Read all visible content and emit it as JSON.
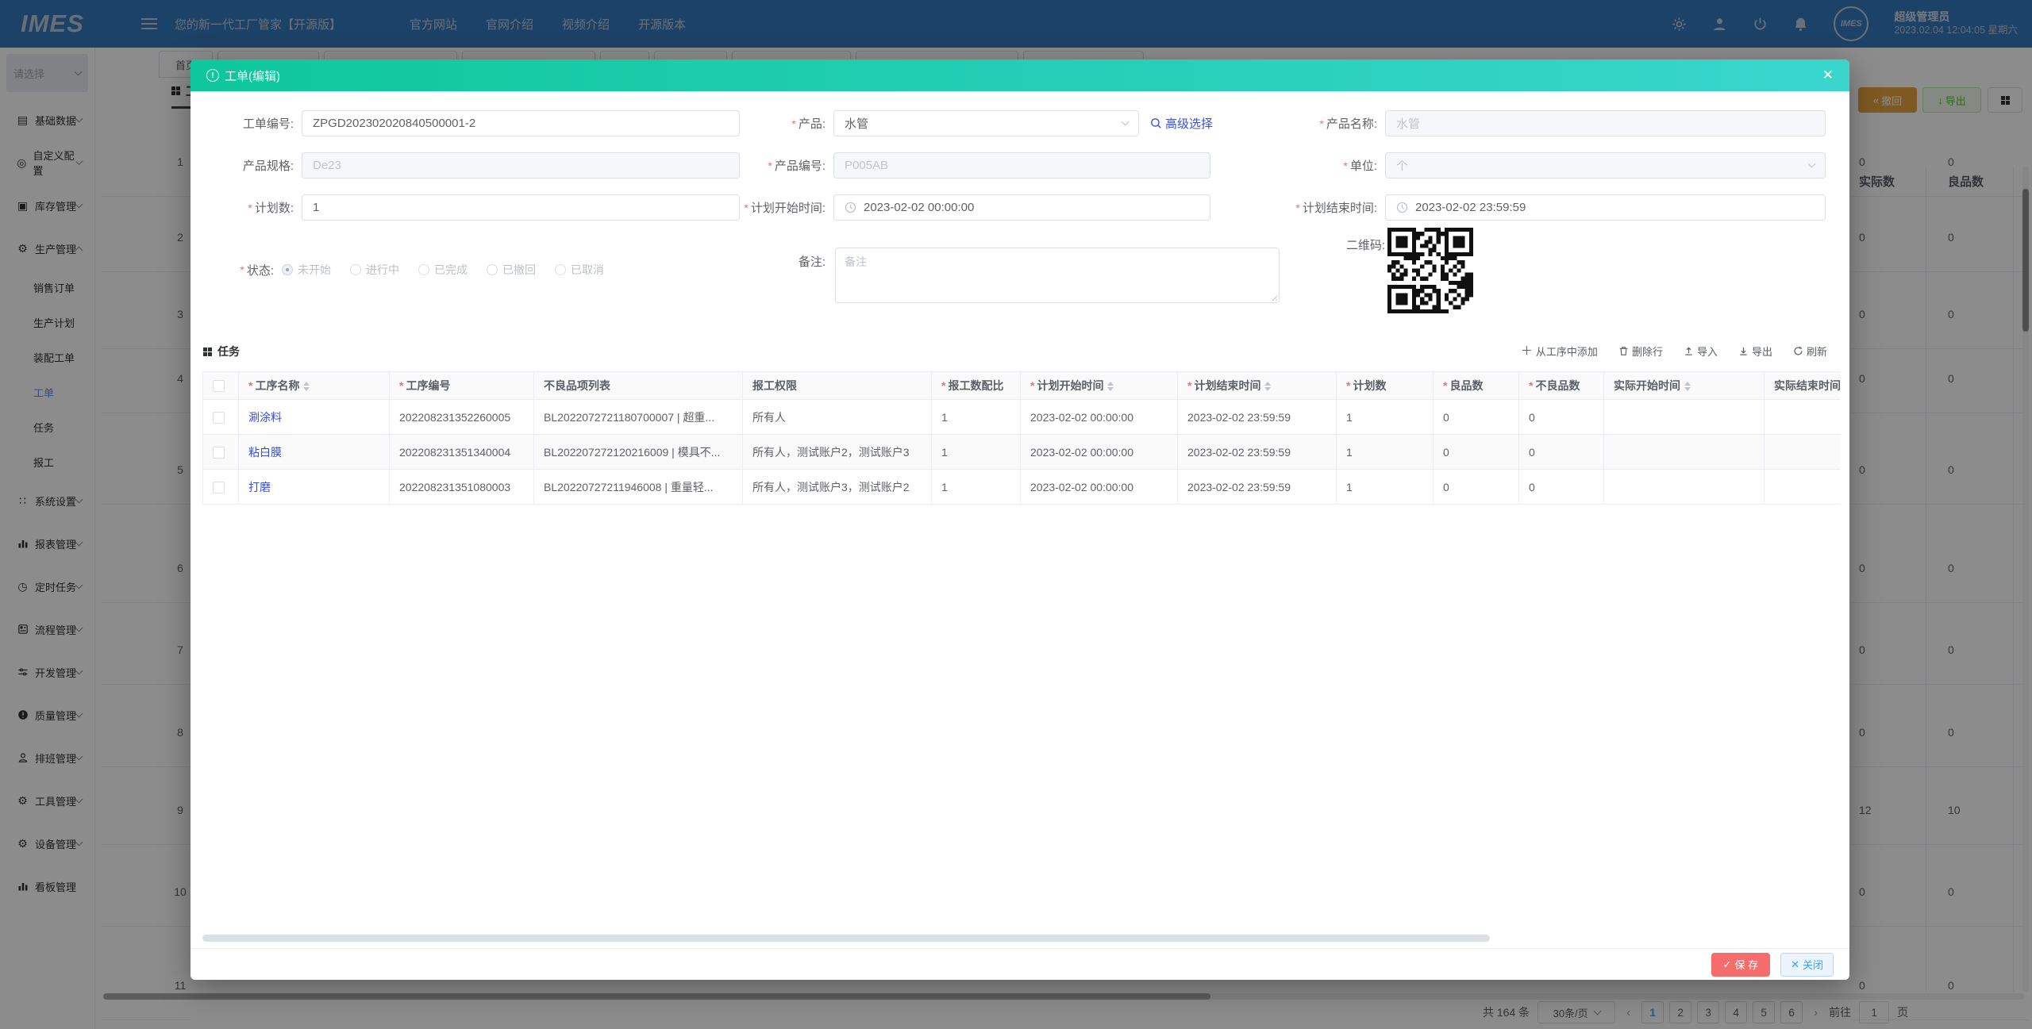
{
  "colors": {
    "teal": "#0ec79b",
    "danger": "#f56c6c",
    "primary": "#409eff",
    "link": "#3b4fd6",
    "warning": "#e6a23c",
    "success": "#67c23a"
  },
  "topbar": {
    "logo": "IMES",
    "app_title": "您的新一代工厂管家【开源版】",
    "nav": [
      "官方网站",
      "官网介绍",
      "视频介绍",
      "开源版本"
    ],
    "icons": [
      "gear-icon",
      "user-icon",
      "power-icon",
      "bell-icon"
    ],
    "avatar_text": "IMES",
    "user_name": "超级管理员",
    "datetime": "2023.02.04 12:04:05 星期六"
  },
  "sidebar": {
    "select_placeholder": "请选择",
    "menu": [
      {
        "label": "基础数据",
        "icon": "database-icon",
        "chevron": "down"
      },
      {
        "label": "自定义配置",
        "icon": "custom-config-icon",
        "chevron": "down"
      },
      {
        "label": "库存管理",
        "icon": "inventory-icon",
        "chevron": "down"
      },
      {
        "label": "生产管理",
        "icon": "production-icon",
        "chevron": "up",
        "expanded": true,
        "children": [
          {
            "label": "销售订单"
          },
          {
            "label": "生产计划"
          },
          {
            "label": "装配工单"
          },
          {
            "label": "工单",
            "active": true
          },
          {
            "label": "任务"
          },
          {
            "label": "报工"
          }
        ]
      },
      {
        "label": "系统设置",
        "icon": "system-settings-icon",
        "chevron": "down"
      },
      {
        "label": "报表管理",
        "icon": "report-icon",
        "chevron": "down"
      },
      {
        "label": "定时任务",
        "icon": "timer-icon",
        "chevron": "down"
      },
      {
        "label": "流程管理",
        "icon": "flow-icon",
        "chevron": "down"
      },
      {
        "label": "开发管理",
        "icon": "dev-icon",
        "chevron": "down"
      },
      {
        "label": "质量管理",
        "icon": "quality-icon",
        "chevron": "down"
      },
      {
        "label": "排班管理",
        "icon": "shift-icon",
        "chevron": "down"
      },
      {
        "label": "工具管理",
        "icon": "tool-icon",
        "chevron": "down"
      },
      {
        "label": "设备管理",
        "icon": "device-icon",
        "chevron": "down"
      },
      {
        "label": "看板管理",
        "icon": "board-icon",
        "chevron": "none"
      }
    ]
  },
  "page": {
    "tab_home": "首页",
    "title": "工单",
    "buttons": {
      "revoke": "撤回",
      "export": "导出"
    },
    "bg_columns": [
      "实际数",
      "良品数"
    ],
    "bg_rows": [
      {
        "n": "1",
        "actual": "0",
        "good": "0"
      },
      {
        "n": "2",
        "actual": "0",
        "good": "0"
      },
      {
        "n": "3",
        "actual": "0",
        "good": "0"
      },
      {
        "n": "4",
        "actual": "0",
        "good": "0"
      },
      {
        "n": "5",
        "actual": "0",
        "good": "0"
      },
      {
        "n": "6",
        "actual": "0",
        "good": "0"
      },
      {
        "n": "7",
        "actual": "0",
        "good": "0"
      },
      {
        "n": "8",
        "actual": "0",
        "good": "0"
      },
      {
        "n": "9",
        "actual": "12",
        "good": "10"
      },
      {
        "n": "10",
        "actual": "0",
        "good": "0"
      },
      {
        "n": "11",
        "actual": "0",
        "good": "0"
      }
    ],
    "pagination": {
      "total": "共 164 条",
      "per_page": "30条/页",
      "prev": "‹",
      "next": "›",
      "pages": [
        "1",
        "2",
        "3",
        "4",
        "5",
        "6"
      ],
      "active_page": "1",
      "goto_label": "前往",
      "goto_value": "1",
      "unit_label": "页"
    }
  },
  "modal": {
    "title": "工单(编辑)",
    "close_glyph": "✕",
    "form": {
      "order_no": {
        "label": "工单编号:",
        "value": "ZPGD202302020840500001-2"
      },
      "product": {
        "label": "产品:",
        "value": "水管"
      },
      "advanced_link": "高级选择",
      "product_name": {
        "label": "产品名称:",
        "value": "水管"
      },
      "spec": {
        "label": "产品规格:",
        "value": "De23"
      },
      "product_no": {
        "label": "产品编号:",
        "value": "P005AB"
      },
      "unit": {
        "label": "单位:",
        "value": "个"
      },
      "plan_qty": {
        "label": "计划数:",
        "value": "1"
      },
      "plan_start": {
        "label": "计划开始时间:",
        "value": "2023-02-02 00:00:00"
      },
      "plan_end": {
        "label": "计划结束时间:",
        "value": "2023-02-02 23:59:59"
      },
      "status": {
        "label": "状态:",
        "options": [
          "未开始",
          "进行中",
          "已完成",
          "已撤回",
          "已取消"
        ],
        "selected_index": 0
      },
      "remark": {
        "label": "备注:",
        "placeholder": "备注"
      },
      "qrcode_label": "二维码:"
    },
    "task": {
      "title": "任务",
      "toolbar": [
        {
          "label": "从工序中添加",
          "icon": "plus-icon"
        },
        {
          "label": "删除行",
          "icon": "trash-icon"
        },
        {
          "label": "导入",
          "icon": "upload-icon"
        },
        {
          "label": "导出",
          "icon": "download-icon"
        },
        {
          "label": "刷新",
          "icon": "refresh-icon"
        }
      ],
      "columns": [
        {
          "label": "工序名称",
          "required": true,
          "sortable": true
        },
        {
          "label": "工序编号",
          "required": true
        },
        {
          "label": "不良品项列表"
        },
        {
          "label": "报工权限"
        },
        {
          "label": "报工数配比",
          "required": true
        },
        {
          "label": "计划开始时间",
          "required": true,
          "sortable": true
        },
        {
          "label": "计划结束时间",
          "required": true,
          "sortable": true
        },
        {
          "label": "计划数",
          "required": true
        },
        {
          "label": "良品数",
          "required": true
        },
        {
          "label": "不良品数",
          "required": true
        },
        {
          "label": "实际开始时间",
          "sortable": true
        },
        {
          "label": "实际结束时间",
          "sortable": true
        }
      ],
      "rows": [
        {
          "name": "涮涂料",
          "code": "202208231352260005",
          "defects": "BL2022072721180700007 | 超重...",
          "permission": "所有人",
          "ratio": "1",
          "plan_start": "2023-02-02 00:00:00",
          "plan_end": "2023-02-02 23:59:59",
          "plan_qty": "1",
          "good": "0",
          "bad": "0",
          "actual_start": "",
          "actual_end": ""
        },
        {
          "name": "粘白膜",
          "code": "202208231351340004",
          "defects": "BL202207272120216009 | 模具不...",
          "permission": "所有人，测试账户2，测试账户3",
          "ratio": "1",
          "plan_start": "2023-02-02 00:00:00",
          "plan_end": "2023-02-02 23:59:59",
          "plan_qty": "1",
          "good": "0",
          "bad": "0",
          "actual_start": "",
          "actual_end": ""
        },
        {
          "name": "打磨",
          "code": "202208231351080003",
          "defects": "BL20220727211946008 | 重量轻...",
          "permission": "所有人，测试账户3，测试账户2",
          "ratio": "1",
          "plan_start": "2023-02-02 00:00:00",
          "plan_end": "2023-02-02 23:59:59",
          "plan_qty": "1",
          "good": "0",
          "bad": "0",
          "actual_start": "",
          "actual_end": ""
        }
      ]
    },
    "footer": {
      "save": "保 存",
      "close": "关闭"
    }
  }
}
